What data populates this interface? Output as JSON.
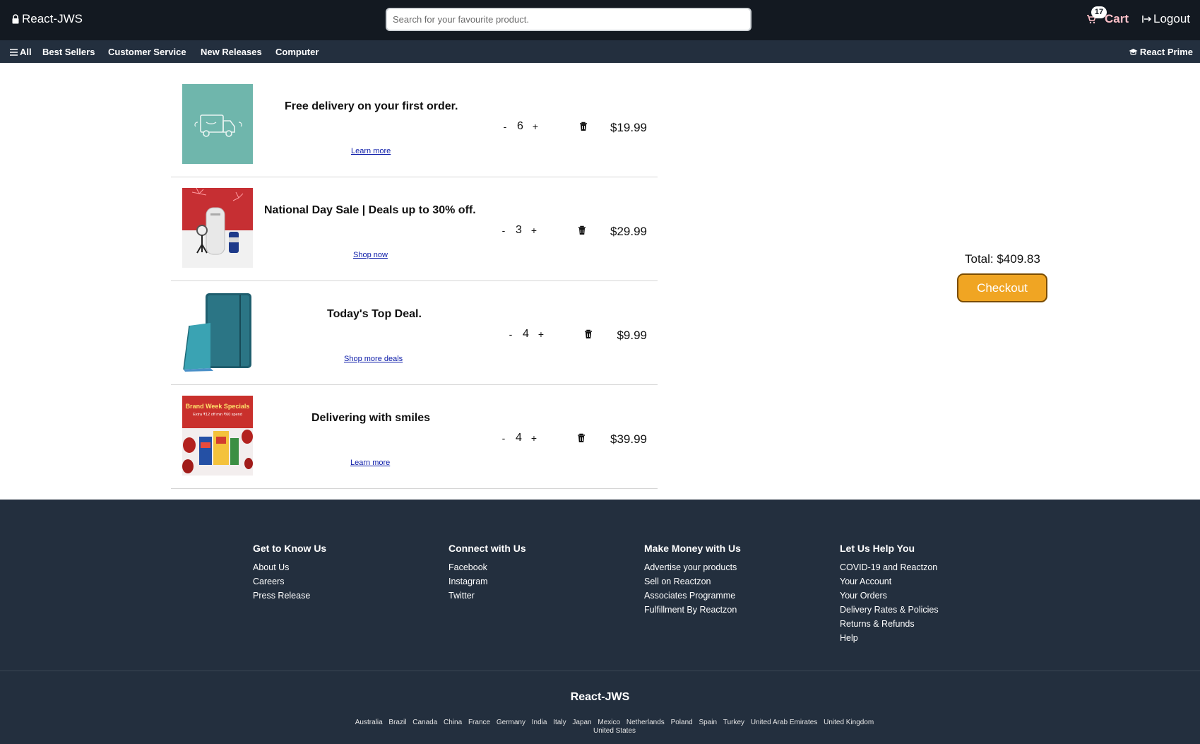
{
  "header": {
    "brand": "React-JWS",
    "search_placeholder": "Search for your favourite product.",
    "cart_count": "17",
    "cart_label": "Cart",
    "logout_label": "Logout"
  },
  "subnav": {
    "all_label": "All",
    "items": [
      "Best Sellers",
      "Customer Service",
      "New Releases",
      "Computer"
    ],
    "prime_label": "React Prime"
  },
  "cart": {
    "items": [
      {
        "title": "Free delivery on your first order.",
        "link": "Learn more",
        "qty": "6",
        "price": "$19.99",
        "minus": "-",
        "plus": "+"
      },
      {
        "title": "National Day Sale | Deals up to 30% off.",
        "link": "Shop now",
        "qty": "3",
        "price": "$29.99",
        "minus": "-",
        "plus": "+"
      },
      {
        "title": "Today's Top Deal.",
        "link": "Shop more deals",
        "qty": "4",
        "price": "$9.99",
        "minus": "-",
        "plus": "+"
      },
      {
        "title": "Delivering with smiles",
        "link": "Learn more",
        "qty": "4",
        "price": "$39.99",
        "minus": "-",
        "plus": "+"
      }
    ],
    "banner_text": {
      "line1": "Brand Week Specials",
      "line2": "Extra ₹12 off min ₹60 spend"
    },
    "total_label": "Total: $409.83",
    "checkout_label": "Checkout"
  },
  "footer": {
    "columns": [
      {
        "heading": "Get to Know Us",
        "links": [
          "About Us",
          "Careers",
          "Press Release"
        ]
      },
      {
        "heading": "Connect with Us",
        "links": [
          "Facebook",
          "Instagram",
          "Twitter"
        ]
      },
      {
        "heading": "Make Money with Us",
        "links": [
          "Advertise your products",
          "Sell on Reactzon",
          "Associates Programme",
          "Fulfillment By Reactzon"
        ]
      },
      {
        "heading": "Let Us Help You",
        "links": [
          "COVID-19 and Reactzon",
          "Your Account",
          "Your Orders",
          "Delivery Rates & Policies",
          "Returns & Refunds",
          "Help"
        ]
      }
    ],
    "brand": "React-JWS",
    "countries": [
      "Australia",
      "Brazil",
      "Canada",
      "China",
      "France",
      "Germany",
      "India",
      "Italy",
      "Japan",
      "Mexico",
      "Netherlands",
      "Poland",
      "Spain",
      "Turkey",
      "United Arab Emirates",
      "United Kingdom",
      "United States"
    ]
  },
  "colors": {
    "header_bg": "#131921",
    "subnav_bg": "#232f3e",
    "footer_bg": "#232f3e",
    "checkout": "#f0a523",
    "cart_text": "#ffc0c8",
    "link": "#0a1aa8"
  }
}
